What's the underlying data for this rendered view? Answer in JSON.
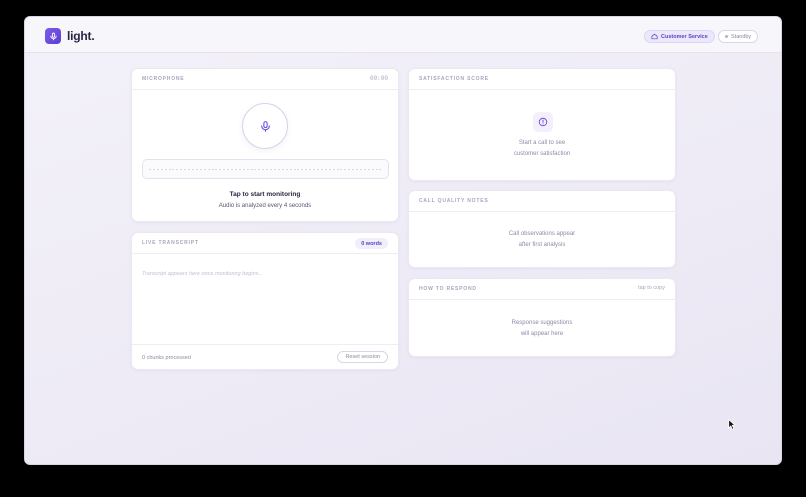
{
  "app": {
    "brand": "light.",
    "mode_pill": "Customer Service",
    "status_pill": "Standby"
  },
  "microphone": {
    "title": "MICROPHONE",
    "timer": "00:00",
    "cta": "Tap to start monitoring",
    "subtitle": "Audio is analyzed every 4 seconds"
  },
  "transcript": {
    "title": "LIVE TRANSCRIPT",
    "word_count": "0 words",
    "placeholder": "Transcript appears here once monitoring begins...",
    "chunks": "0 chunks processed",
    "reset_label": "Reset session"
  },
  "satisfaction": {
    "title": "SATISFACTION SCORE",
    "empty_line1": "Start a call to see",
    "empty_line2": "customer satisfaction"
  },
  "quality": {
    "title": "CALL QUALITY NOTES",
    "empty_line1": "Call observations appear",
    "empty_line2": "after first analysis"
  },
  "respond": {
    "title": "HOW TO RESPOND",
    "meta": "tap to copy",
    "empty_line1": "Response suggestions",
    "empty_line2": "will appear here"
  },
  "icons": {
    "logo": "microphone-icon",
    "mode": "home-icon",
    "status": "dot-icon",
    "mic": "microphone-icon",
    "satisfaction": "info-circle-icon",
    "cursor": "mouse-pointer-icon"
  },
  "colors": {
    "accent": "#6a4be0",
    "background": "#efecf6",
    "card": "#ffffff",
    "muted_text": "#a9a5bb"
  }
}
